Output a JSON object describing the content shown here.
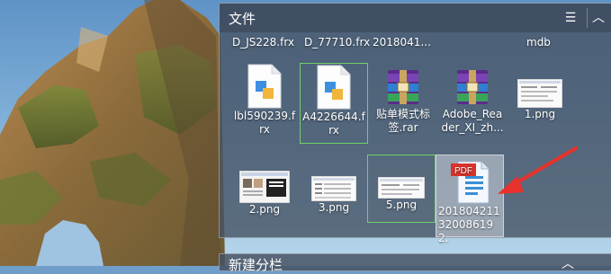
{
  "fence": {
    "title": "文件",
    "menu_icon": "☰",
    "collapse_icon": "︿"
  },
  "top_row_labels": [
    "D_JS228.frx",
    "D_77710.frx",
    "2018041...",
    "mdb"
  ],
  "items": [
    {
      "label": "lbl590239.frx",
      "icon": "frx-file-icon"
    },
    {
      "label": "A4226644.frx",
      "icon": "frx-file-icon"
    },
    {
      "label": "贴单模式标签.rar",
      "icon": "winrar-archive-icon"
    },
    {
      "label": "Adobe_Reader_XI_zh...",
      "icon": "winrar-archive-icon"
    },
    {
      "label": "1.png",
      "icon": "png-thumbnail-icon"
    },
    {
      "label": "2.png",
      "icon": "png-thumbnail-icon"
    },
    {
      "label": "3.png",
      "icon": "png-thumbnail-icon"
    },
    {
      "label": "5.png",
      "icon": "png-thumbnail-icon"
    },
    {
      "label": "20180421132008619 2.",
      "icon": "pdf-file-icon"
    }
  ],
  "pdf_badge": "PDF",
  "fence2": {
    "title": "新建分栏",
    "collapse_icon": "︿"
  },
  "colors": {
    "accent_arrow": "#e8322b",
    "selection_green": "#6fd06a",
    "panel_bg": "#465264"
  }
}
